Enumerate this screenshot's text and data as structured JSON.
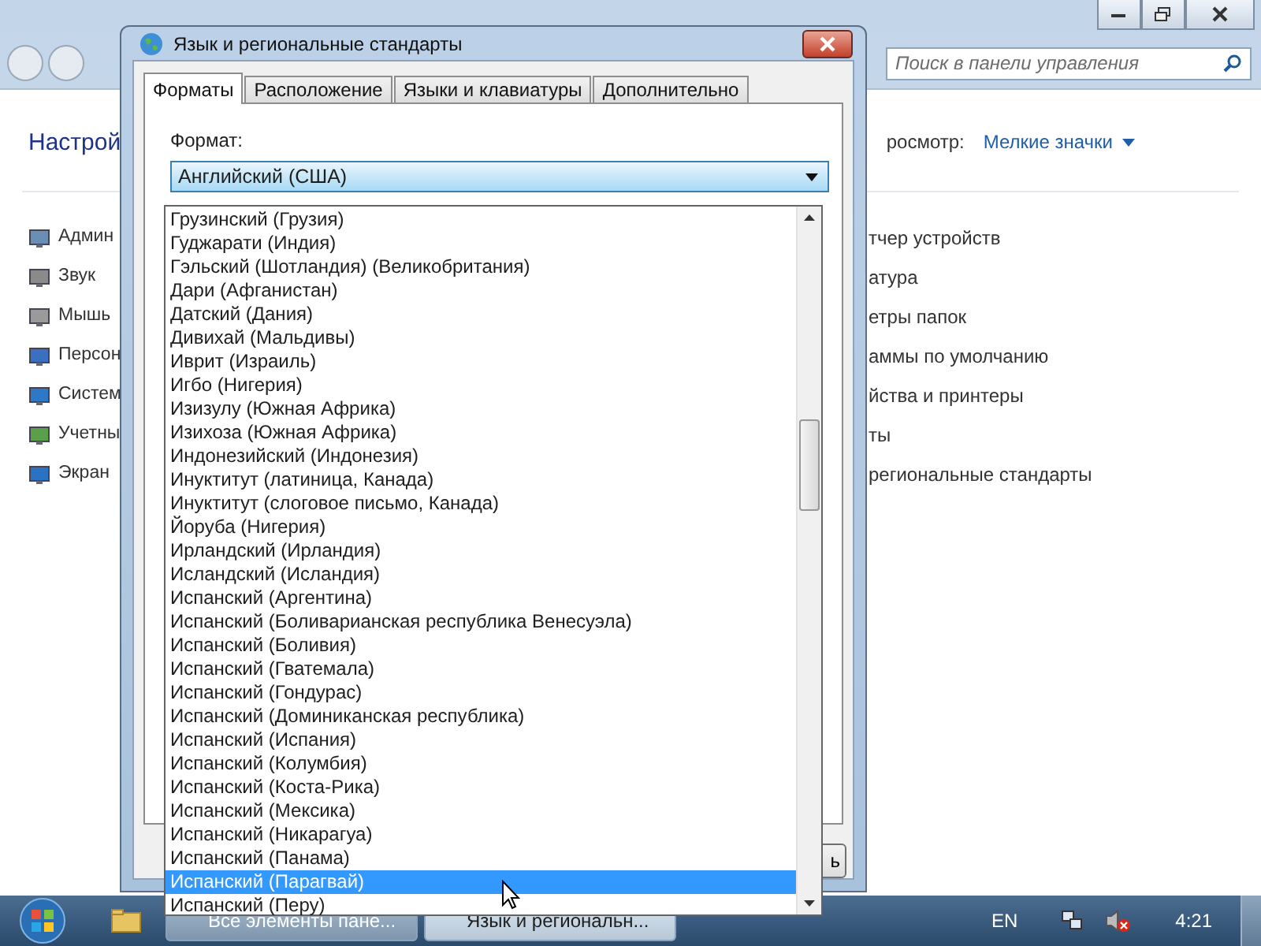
{
  "control_panel": {
    "header_fragment": "Настрой",
    "search_placeholder": "Поиск в панели управления",
    "view_label_fragment": "росмотр:",
    "view_value": "Мелкие значки",
    "left_items": [
      "Админ",
      "Звук",
      "Мышь",
      "Персон",
      "Систем",
      "Учетны",
      "Экран"
    ],
    "right_items": [
      "тчер устройств",
      "атура",
      "етры папок",
      "аммы по умолчанию",
      "йства и принтеры",
      "ты",
      "региональные стандарты"
    ]
  },
  "dialog": {
    "title": "Язык и региональные стандарты",
    "tabs": [
      {
        "label": "Форматы",
        "selected": true
      },
      {
        "label": "Расположение",
        "selected": false
      },
      {
        "label": "Языки и клавиатуры",
        "selected": false
      },
      {
        "label": "Дополнительно",
        "selected": false
      }
    ],
    "format_label": "Формат:",
    "format_value": "Английский (США)",
    "button_fragment": "ь",
    "options": [
      {
        "label": "Грузинский (Грузия)",
        "selected": false
      },
      {
        "label": "Гуджарати (Индия)",
        "selected": false
      },
      {
        "label": "Гэльский (Шотландия) (Великобритания)",
        "selected": false
      },
      {
        "label": "Дари (Афганистан)",
        "selected": false
      },
      {
        "label": "Датский (Дания)",
        "selected": false
      },
      {
        "label": "Дивихай (Мальдивы)",
        "selected": false
      },
      {
        "label": "Иврит (Израиль)",
        "selected": false
      },
      {
        "label": "Игбо (Нигерия)",
        "selected": false
      },
      {
        "label": "Изизулу (Южная Африка)",
        "selected": false
      },
      {
        "label": "Изихоза (Южная Африка)",
        "selected": false
      },
      {
        "label": "Индонезийский (Индонезия)",
        "selected": false
      },
      {
        "label": "Инуктитут (латиница, Канада)",
        "selected": false
      },
      {
        "label": "Инуктитут (слоговое письмо, Канада)",
        "selected": false
      },
      {
        "label": "Йоруба (Нигерия)",
        "selected": false
      },
      {
        "label": "Ирландский (Ирландия)",
        "selected": false
      },
      {
        "label": "Исландский (Исландия)",
        "selected": false
      },
      {
        "label": "Испанский (Аргентина)",
        "selected": false
      },
      {
        "label": "Испанский (Боливарианская республика Венесуэла)",
        "selected": false
      },
      {
        "label": "Испанский (Боливия)",
        "selected": false
      },
      {
        "label": "Испанский (Гватемала)",
        "selected": false
      },
      {
        "label": "Испанский (Гондурас)",
        "selected": false
      },
      {
        "label": "Испанский (Доминиканская республика)",
        "selected": false
      },
      {
        "label": "Испанский (Испания)",
        "selected": false
      },
      {
        "label": "Испанский (Колумбия)",
        "selected": false
      },
      {
        "label": "Испанский (Коста-Рика)",
        "selected": false
      },
      {
        "label": "Испанский (Мексика)",
        "selected": false
      },
      {
        "label": "Испанский (Никарагуа)",
        "selected": false
      },
      {
        "label": "Испанский (Панама)",
        "selected": false
      },
      {
        "label": "Испанский (Парагвай)",
        "selected": true
      },
      {
        "label": "Испанский (Перу)",
        "selected": false
      }
    ]
  },
  "taskbar": {
    "tasks": [
      {
        "label": "Все элементы пане...",
        "selected": false
      },
      {
        "label": "Язык и региональн...",
        "selected": true
      }
    ],
    "language": "EN",
    "clock": "4:21"
  }
}
